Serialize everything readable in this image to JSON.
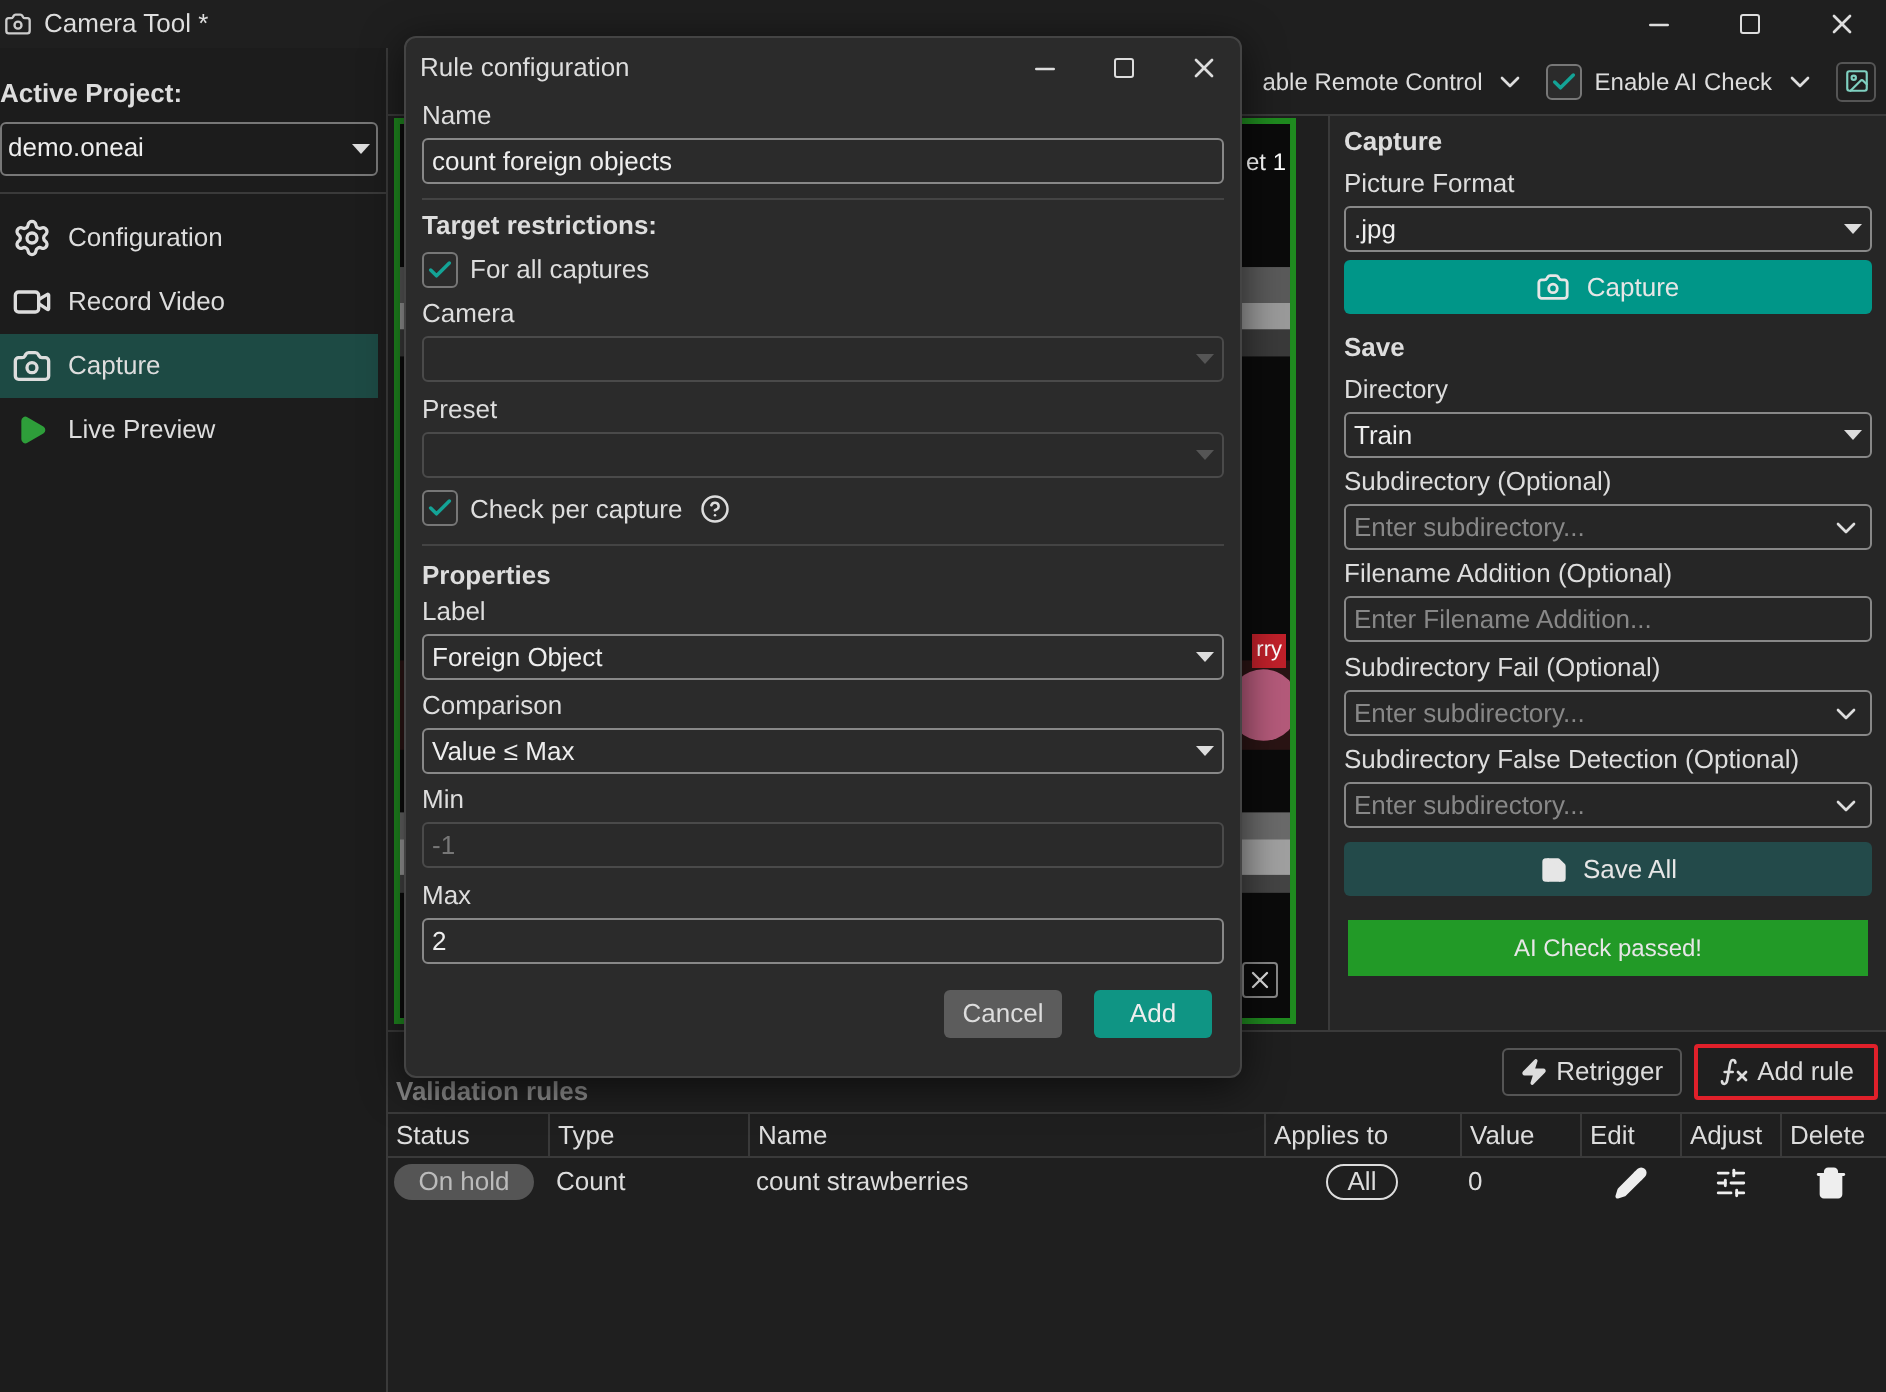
{
  "window": {
    "title": "Camera Tool *"
  },
  "sidebar": {
    "project_label": "Active Project:",
    "project": "demo.oneai",
    "items": [
      {
        "label": "Configuration",
        "selected": false
      },
      {
        "label": "Record Video",
        "selected": false
      },
      {
        "label": "Capture",
        "selected": true
      },
      {
        "label": "Live Preview",
        "selected": false
      }
    ]
  },
  "toolbar": {
    "remote_control": {
      "label": "able Remote Control"
    },
    "ai_check": {
      "label": "Enable AI Check",
      "checked": true
    }
  },
  "preview": {
    "overlay_title": "et 1",
    "detection_label": "rry"
  },
  "capture": {
    "heading": "Capture",
    "format": {
      "label": "Picture Format",
      "value": ".jpg"
    },
    "button": "Capture"
  },
  "save": {
    "heading": "Save",
    "fields": [
      {
        "kind": "select",
        "label": "Directory",
        "value": "Train"
      },
      {
        "kind": "combo",
        "label": "Subdirectory (Optional)",
        "placeholder": "Enter subdirectory..."
      },
      {
        "kind": "input",
        "label": "Filename Addition (Optional)",
        "placeholder": "Enter Filename Addition..."
      },
      {
        "kind": "combo",
        "label": "Subdirectory Fail (Optional)",
        "placeholder": "Enter subdirectory..."
      },
      {
        "kind": "combo",
        "label": "Subdirectory False Detection (Optional)",
        "placeholder": "Enter subdirectory..."
      }
    ],
    "button": "Save All"
  },
  "ai_status": "AI Check passed!",
  "validation": {
    "title": "Validation rules",
    "retrigger": "Retrigger",
    "add_rule": {
      "label": "Add rule",
      "highlighted": true
    },
    "columns": [
      "Status",
      "Type",
      "Name",
      "Applies to",
      "Value",
      "Edit",
      "Adjust",
      "Delete"
    ],
    "rows": [
      {
        "status": "On hold",
        "type": "Count",
        "name": "count strawberries",
        "applies_to": "All",
        "value": "0"
      }
    ]
  },
  "dialog": {
    "title": "Rule configuration",
    "name": {
      "label": "Name",
      "value": "count foreign objects"
    },
    "target": {
      "heading": "Target restrictions:",
      "all_captures": {
        "label": "For all captures",
        "checked": true
      },
      "camera": {
        "label": "Camera",
        "disabled": true
      },
      "preset": {
        "label": "Preset",
        "disabled": true
      },
      "per_capture": {
        "label": "Check per capture",
        "checked": true
      }
    },
    "properties": {
      "heading": "Properties",
      "label": {
        "label": "Label",
        "value": "Foreign Object"
      },
      "comparison": {
        "label": "Comparison",
        "value": "Value ≤ Max"
      },
      "min": {
        "label": "Min",
        "value": "-1",
        "disabled": true
      },
      "max": {
        "label": "Max",
        "value": "2",
        "disabled": false
      }
    },
    "cancel": "Cancel",
    "add": "Add"
  }
}
